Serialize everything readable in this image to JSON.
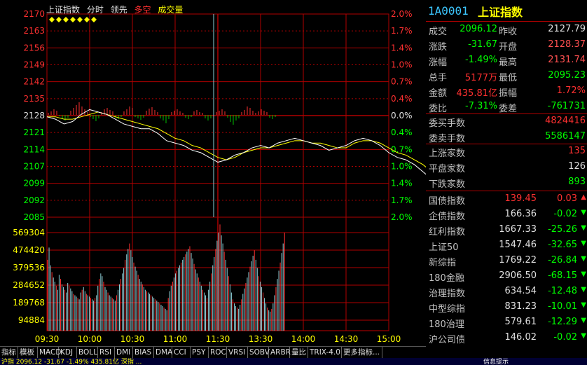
{
  "chart_header": {
    "index_name": "上证指数",
    "mode": "分时",
    "indicator1": "领先",
    "indicator2": "多空",
    "indicator3": "成交量"
  },
  "chart_data": {
    "type": "line",
    "price_axis": [
      "2170",
      "2163",
      "2156",
      "2149",
      "2142",
      "2135",
      "2128",
      "2121",
      "2114",
      "2107",
      "2099",
      "2092",
      "2085"
    ],
    "pct_axis": [
      "2.0%",
      "1.7%",
      "1.4%",
      "1.0%",
      "0.7%",
      "0.4%",
      "0.0%",
      "0.4%",
      "0.7%",
      "1.0%",
      "1.4%",
      "1.7%",
      "2.0%"
    ],
    "volume_axis": [
      "569304",
      "474420",
      "379536",
      "284652",
      "189768",
      "94884"
    ],
    "time_axis": [
      "09:30",
      "10:00",
      "10:30",
      "11:00",
      "11:30",
      "13:30",
      "14:00",
      "14:30",
      "15:00"
    ],
    "prev_close": 2127.79,
    "ylim": [
      2085,
      2170
    ],
    "time_grid": [
      "09:30",
      "10:00",
      "10:30",
      "11:00",
      "11:30",
      "13:30",
      "14:00",
      "14:30",
      "15:00"
    ],
    "price": [
      [
        0,
        2127
      ],
      [
        6,
        2126
      ],
      [
        12,
        2124
      ],
      [
        18,
        2125
      ],
      [
        24,
        2128
      ],
      [
        30,
        2130
      ],
      [
        36,
        2129
      ],
      [
        42,
        2128
      ],
      [
        48,
        2126
      ],
      [
        54,
        2124
      ],
      [
        60,
        2123
      ],
      [
        66,
        2122
      ],
      [
        72,
        2122
      ],
      [
        78,
        2120
      ],
      [
        84,
        2117
      ],
      [
        90,
        2116
      ],
      [
        96,
        2115
      ],
      [
        102,
        2113
      ],
      [
        108,
        2112
      ],
      [
        114,
        2110
      ],
      [
        120,
        2108
      ],
      [
        126,
        2109
      ],
      [
        132,
        2111
      ],
      [
        138,
        2112
      ],
      [
        144,
        2114
      ],
      [
        150,
        2115
      ],
      [
        156,
        2114
      ],
      [
        162,
        2116
      ],
      [
        168,
        2117
      ],
      [
        174,
        2118
      ],
      [
        180,
        2117
      ],
      [
        186,
        2116
      ],
      [
        192,
        2115
      ],
      [
        198,
        2113
      ],
      [
        204,
        2114
      ],
      [
        210,
        2115
      ],
      [
        216,
        2117
      ],
      [
        222,
        2118
      ],
      [
        228,
        2117
      ],
      [
        234,
        2115
      ],
      [
        240,
        2112
      ],
      [
        246,
        2110
      ],
      [
        252,
        2109
      ],
      [
        258,
        2107
      ],
      [
        264,
        2104
      ],
      [
        270,
        2101
      ],
      [
        276,
        2098
      ],
      [
        282,
        2096
      ]
    ],
    "avg": [
      [
        0,
        2127
      ],
      [
        6,
        2127
      ],
      [
        12,
        2126
      ],
      [
        18,
        2126
      ],
      [
        24,
        2127
      ],
      [
        30,
        2128
      ],
      [
        36,
        2129
      ],
      [
        42,
        2128
      ],
      [
        48,
        2127
      ],
      [
        54,
        2126
      ],
      [
        60,
        2125
      ],
      [
        66,
        2124
      ],
      [
        72,
        2123
      ],
      [
        78,
        2122
      ],
      [
        84,
        2120
      ],
      [
        90,
        2118
      ],
      [
        96,
        2117
      ],
      [
        102,
        2115
      ],
      [
        108,
        2114
      ],
      [
        114,
        2112
      ],
      [
        120,
        2110
      ],
      [
        126,
        2109
      ],
      [
        132,
        2110
      ],
      [
        138,
        2112
      ],
      [
        144,
        2113
      ],
      [
        150,
        2114
      ],
      [
        156,
        2114
      ],
      [
        162,
        2115
      ],
      [
        168,
        2116
      ],
      [
        174,
        2117
      ],
      [
        180,
        2117
      ],
      [
        186,
        2116
      ],
      [
        192,
        2116
      ],
      [
        198,
        2115
      ],
      [
        204,
        2114
      ],
      [
        210,
        2114
      ],
      [
        216,
        2116
      ],
      [
        222,
        2117
      ],
      [
        228,
        2117
      ],
      [
        234,
        2116
      ],
      [
        240,
        2114
      ],
      [
        246,
        2112
      ],
      [
        252,
        2111
      ],
      [
        258,
        2109
      ],
      [
        264,
        2107
      ],
      [
        270,
        2104
      ],
      [
        276,
        2101
      ],
      [
        282,
        2098
      ]
    ],
    "macd_bars": [
      3,
      5,
      8,
      6,
      -2,
      -5,
      -8,
      -4,
      6,
      10,
      14,
      18,
      12,
      8,
      4,
      -3,
      -6,
      -9,
      -5,
      4,
      8,
      10,
      7,
      5,
      -4,
      -6,
      -3,
      5,
      8,
      12,
      10,
      -3,
      -5,
      -7,
      -4,
      6,
      9,
      11,
      7,
      4,
      -5,
      -8,
      -12,
      -6,
      4,
      6,
      8,
      5,
      3,
      -4,
      -6,
      -3,
      5,
      7,
      4,
      3,
      -5,
      -8,
      -5,
      -3,
      4,
      6,
      8,
      5,
      -4,
      -10,
      -14,
      -8,
      -5,
      4,
      7,
      12,
      10,
      6,
      3,
      5,
      8,
      6,
      4,
      -4,
      -6,
      -3
    ],
    "volume": [
      520,
      610,
      480,
      430,
      390,
      360,
      330,
      300,
      410,
      380,
      340,
      320,
      300,
      280,
      350,
      330,
      310,
      290,
      270,
      260,
      250,
      240,
      230,
      280,
      300,
      320,
      290,
      270,
      260,
      250,
      240,
      230,
      220,
      240,
      260,
      330,
      380,
      420,
      400,
      360,
      320,
      300,
      280,
      260,
      250,
      240,
      230,
      220,
      260,
      300,
      340,
      380,
      420,
      460,
      520,
      560,
      600,
      640,
      590,
      540,
      500,
      470,
      440,
      410,
      380,
      360,
      340,
      320,
      300,
      290,
      280,
      270,
      260,
      250,
      240,
      230,
      220,
      210,
      200,
      190,
      180,
      170,
      160,
      150,
      240,
      290,
      330,
      360,
      390,
      420,
      440,
      460,
      480,
      500,
      520,
      540,
      560,
      580,
      600,
      620,
      570,
      530,
      490,
      450,
      420,
      390,
      360,
      330,
      300,
      280,
      260,
      240,
      300,
      360,
      420,
      480,
      540,
      600,
      660,
      720,
      780,
      700,
      640,
      580,
      520,
      460,
      400,
      340,
      280,
      230,
      200,
      180,
      170,
      160,
      190,
      230,
      270,
      310,
      350,
      390,
      430,
      470,
      510,
      550,
      590,
      520,
      460,
      400,
      360,
      320,
      280,
      240,
      200,
      170,
      150,
      140,
      160,
      200,
      260,
      320,
      380,
      440,
      500,
      570,
      640,
      720
    ]
  },
  "right_panel": {
    "code": "1A0001",
    "name": "上证指数",
    "quote": [
      {
        "l1": "成交",
        "v1": "2096.12",
        "c1": "#00ff00",
        "l2": "昨收",
        "v2": "2127.79",
        "c2": "#e0e0e0"
      },
      {
        "l1": "涨跌",
        "v1": "-31.67",
        "c1": "#00ff00",
        "l2": "开盘",
        "v2": "2128.37",
        "c2": "#ff5050"
      },
      {
        "l1": "涨幅",
        "v1": "-1.49%",
        "c1": "#00ff00",
        "l2": "最高",
        "v2": "2131.74",
        "c2": "#ff5050"
      },
      {
        "l1": "总手",
        "v1": "5177万",
        "c1": "#ff3030",
        "l2": "最低",
        "v2": "2095.23",
        "c2": "#00ff00"
      },
      {
        "l1": "金额",
        "v1": "435.81亿",
        "c1": "#ff3030",
        "l2": "振幅",
        "v2": "1.72%",
        "c2": "#ff3030"
      },
      {
        "l1": "委比",
        "v1": "-7.31%",
        "c1": "#00ff00",
        "l2": "委差",
        "v2": "-761731",
        "c2": "#00ff00"
      }
    ],
    "orders": [
      {
        "l": "委买手数",
        "v": "4824416",
        "c": "#ff3030"
      },
      {
        "l": "委卖手数",
        "v": "5586147",
        "c": "#00ff00"
      }
    ],
    "breadth": [
      {
        "l": "上涨家数",
        "v": "135",
        "c": "#ff3030"
      },
      {
        "l": "平盘家数",
        "v": "126",
        "c": "#e0e0e0"
      },
      {
        "l": "下跌家数",
        "v": "893",
        "c": "#00ff00"
      }
    ],
    "indices": [
      {
        "n": "国债指数",
        "p": "139.45",
        "c": "0.03",
        "pc": "#ff3030",
        "cc": "#ff3030",
        "arrow": "▲",
        "ac": "#ff3030"
      },
      {
        "n": "企债指数",
        "p": "166.36",
        "c": "-0.02",
        "pc": "#e0e0e0",
        "cc": "#00ff00",
        "arrow": "▼",
        "ac": "#00ff00"
      },
      {
        "n": "红利指数",
        "p": "1667.33",
        "c": "-25.26",
        "pc": "#e0e0e0",
        "cc": "#00ff00",
        "arrow": "▼",
        "ac": "#00ff00"
      },
      {
        "n": "上证50",
        "p": "1547.46",
        "c": "-32.65",
        "pc": "#e0e0e0",
        "cc": "#00ff00",
        "arrow": "▼",
        "ac": "#00ff00"
      },
      {
        "n": "新综指",
        "p": "1769.22",
        "c": "-26.84",
        "pc": "#e0e0e0",
        "cc": "#00ff00",
        "arrow": "▼",
        "ac": "#00ff00"
      },
      {
        "n": "180金融",
        "p": "2906.50",
        "c": "-68.15",
        "pc": "#e0e0e0",
        "cc": "#00ff00",
        "arrow": "▼",
        "ac": "#00ff00"
      },
      {
        "n": "治理指数",
        "p": "634.54",
        "c": "-12.48",
        "pc": "#e0e0e0",
        "cc": "#00ff00",
        "arrow": "▼",
        "ac": "#00ff00"
      },
      {
        "n": "中型综指",
        "p": "831.23",
        "c": "-10.01",
        "pc": "#e0e0e0",
        "cc": "#00ff00",
        "arrow": "▼",
        "ac": "#00ff00"
      },
      {
        "n": "180治理",
        "p": "579.61",
        "c": "-12.29",
        "pc": "#e0e0e0",
        "cc": "#00ff00",
        "arrow": "▼",
        "ac": "#00ff00"
      },
      {
        "n": "沪公司债",
        "p": "146.02",
        "c": "-0.02",
        "pc": "#e0e0e0",
        "cc": "#00ff00",
        "arrow": "▼",
        "ac": "#00ff00"
      }
    ]
  },
  "tabs": [
    "指标",
    "模板",
    "MACD",
    "KDJ",
    "BOLL",
    "RSI",
    "DMI",
    "BIAS",
    "DMA",
    "CCI",
    "PSY",
    "ROC",
    "VRSI",
    "SOBV",
    "ARBR",
    "量比",
    "TRIX-4.0",
    "更多指标..."
  ],
  "status": {
    "left": "沪指 2096.12 -31.67 -1.49% 435.81亿  深指 ...",
    "right": "信息提示"
  }
}
